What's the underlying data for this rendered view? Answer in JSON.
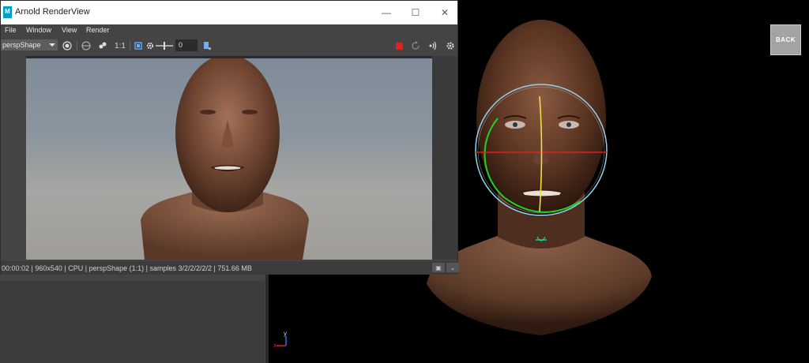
{
  "window": {
    "title": "Arnold RenderView",
    "logo_letter": "M",
    "controls": {
      "minimize": "—",
      "maximize": "☐",
      "close": "✕"
    }
  },
  "menu": [
    "File",
    "Window",
    "View",
    "Render"
  ],
  "toolbar": {
    "camera": "perspShape",
    "ratio_label": "1:1",
    "exposure_value": "0"
  },
  "status": {
    "text": "00:00:02 | 960x540 | CPU | perspShape (1:1) | samples 3/2/2/2/2/2 | 751.66 MB"
  },
  "viewport": {
    "back_label": "BACK",
    "axis_x": "x",
    "axis_y": "y"
  },
  "colors": {
    "accent": "#00a0c6",
    "stop": "#dd2222",
    "gizmo_ring": "#8fd3f0",
    "gizmo_green": "#22d022",
    "gizmo_red": "#e02020",
    "gizmo_yellow": "#f0e040"
  }
}
